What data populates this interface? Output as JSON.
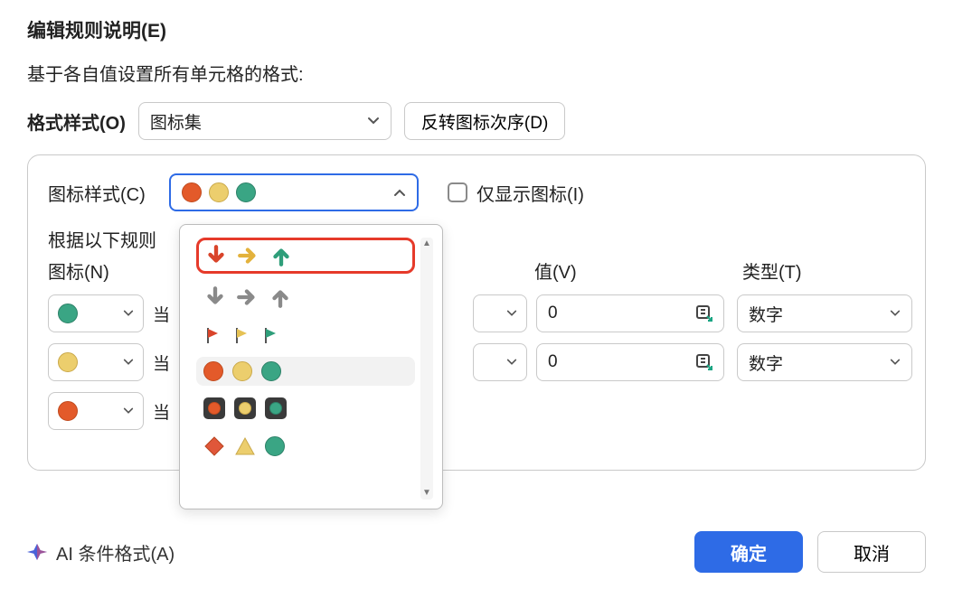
{
  "title": "编辑规则说明(E)",
  "subtitle": "基于各自值设置所有单元格的格式:",
  "format_style": {
    "label": "格式样式(O)",
    "value": "图标集",
    "reverse_button": "反转图标次序(D)"
  },
  "panel": {
    "icon_style_label": "图标样式(C)",
    "show_icon_only_label": "仅显示图标(I)",
    "rules_prefix_label": "根据以下规则",
    "headers": {
      "icon": "图标(N)",
      "value": "值(V)",
      "type": "类型(T)"
    },
    "rows": [
      {
        "suffix": "当",
        "value": "0",
        "type": "数字",
        "dot": "green"
      },
      {
        "suffix": "当",
        "value": "0",
        "type": "数字",
        "dot": "yellow"
      },
      {
        "suffix": "当",
        "value": "",
        "type": "",
        "dot": "red"
      }
    ]
  },
  "popup": {
    "options": [
      {
        "kind": "arrows-color",
        "highlight": true
      },
      {
        "kind": "arrows-grey"
      },
      {
        "kind": "flags"
      },
      {
        "kind": "circles",
        "hover": true
      },
      {
        "kind": "traffic-squares"
      },
      {
        "kind": "shapes"
      }
    ]
  },
  "footer": {
    "ai_label": "AI 条件格式(A)",
    "ok": "确定",
    "cancel": "取消"
  },
  "colors": {
    "red": "#e35a2a",
    "yellow": "#ecce6d",
    "green": "#3aa584",
    "primary": "#2e6be6"
  }
}
